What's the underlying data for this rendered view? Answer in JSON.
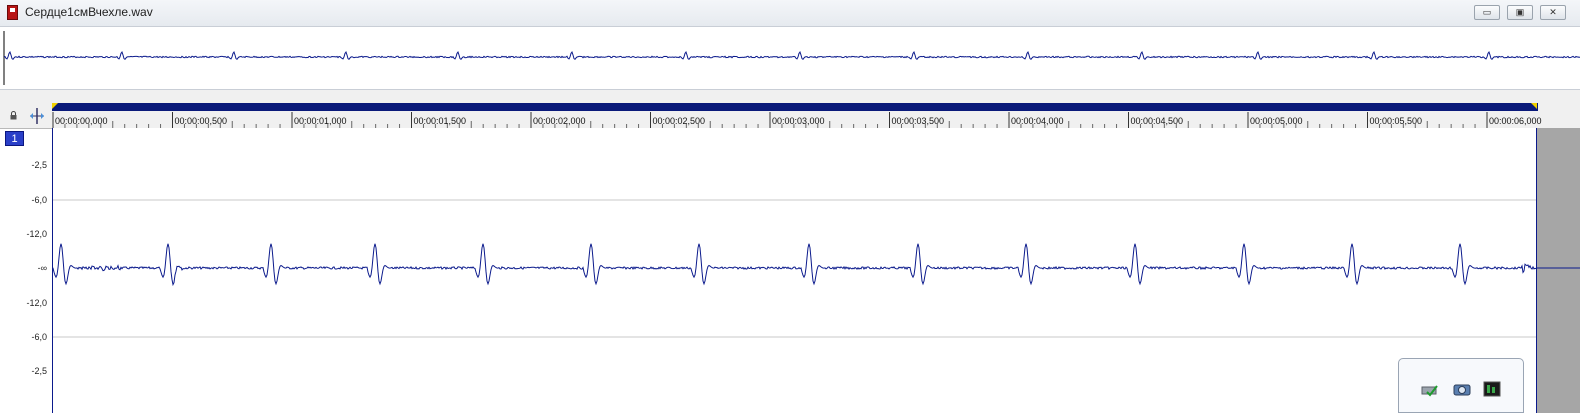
{
  "window": {
    "title": "Сердце1смВчехле.wav",
    "minimize_glyph": "▭",
    "restore_glyph": "▣",
    "close_glyph": "✕"
  },
  "timeline": {
    "ticks": [
      "00:00:00,000",
      "00:00:00,500",
      "00:00:01,000",
      "00:00:01,500",
      "00:00:02,000",
      "00:00:02,500",
      "00:00:03,000",
      "00:00:03,500",
      "00:00:04,000",
      "00:00:04,500",
      "00:00:05,000",
      "00:00:05,500",
      "00:00:06,000"
    ]
  },
  "channel": {
    "number": "1",
    "db_labels": [
      "-2,5",
      "-6,0",
      "-12,0",
      "-∞",
      "-12,0",
      "-6,0",
      "-2,5"
    ]
  },
  "icons": {
    "lock": "lock-icon",
    "snap": "snap-icon",
    "tray": [
      "network-icon",
      "camera-icon",
      "speaker-icon"
    ]
  },
  "colors": {
    "waveform": "#0b1a8c",
    "selection_bar": "#0a1a7a",
    "channel_badge": "#2a3fc8",
    "marker": "#f2d100"
  }
}
